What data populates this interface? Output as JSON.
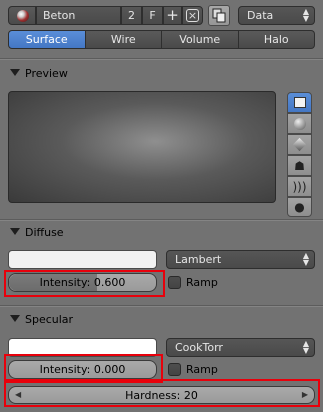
{
  "header": {
    "material_name": "Beton",
    "user_count": "2",
    "fake_user": "F",
    "add_icon": "plus-icon",
    "unlink_icon": "x-box-icon",
    "browse_icon": "copy-icon",
    "context_select": "Data"
  },
  "tabs": [
    {
      "label": "Surface",
      "active": true
    },
    {
      "label": "Wire",
      "active": false
    },
    {
      "label": "Volume",
      "active": false
    },
    {
      "label": "Halo",
      "active": false
    }
  ],
  "preview": {
    "title": "Preview",
    "buttons": [
      "flat-icon",
      "sphere-icon",
      "cube-icon",
      "monkey-icon",
      "hair-icon",
      "sphere-a-icon"
    ]
  },
  "diffuse": {
    "title": "Diffuse",
    "color": "#f2f2f2",
    "shader": "Lambert",
    "intensity_label": "Intensity: 0.600",
    "intensity_value": 0.6,
    "ramp_label": "Ramp",
    "ramp_checked": false
  },
  "specular": {
    "title": "Specular",
    "color": "#ffffff",
    "shader": "CookTorr",
    "intensity_label": "Intensity: 0.000",
    "intensity_value": 0.0,
    "ramp_label": "Ramp",
    "ramp_checked": false,
    "hardness_label": "Hardness: 20"
  },
  "colors": {
    "accent_blue": "#4a7fd0",
    "highlight_red": "#e8000b",
    "background": "#727272"
  }
}
